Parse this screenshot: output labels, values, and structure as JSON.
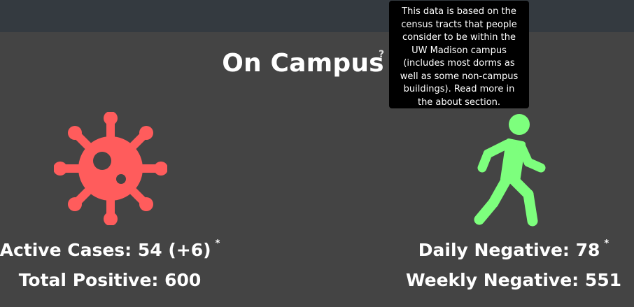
{
  "header": {},
  "main": {
    "title": "On Campus",
    "help_mark": "?",
    "tooltip_text": "This data is based on the census tracts that people consider to be within the UW Madison campus (includes most dorms as well as some non-campus buildings). Read more in the about section."
  },
  "positive": {
    "active_cases": "Active Cases: 54 (+6)",
    "active_asterisk": "*",
    "total_positive": "Total Positive: 600",
    "icon": "virus-icon",
    "color": "#ff5c5c"
  },
  "negative": {
    "daily_negative": "Daily Negative: 78",
    "daily_asterisk": "*",
    "weekly_negative": "Weekly Negative: 551",
    "icon": "walking-person-icon",
    "color": "#7dff7d"
  },
  "colors": {
    "background": "#444444",
    "topbar": "#343a40",
    "tooltip": "#000000"
  }
}
